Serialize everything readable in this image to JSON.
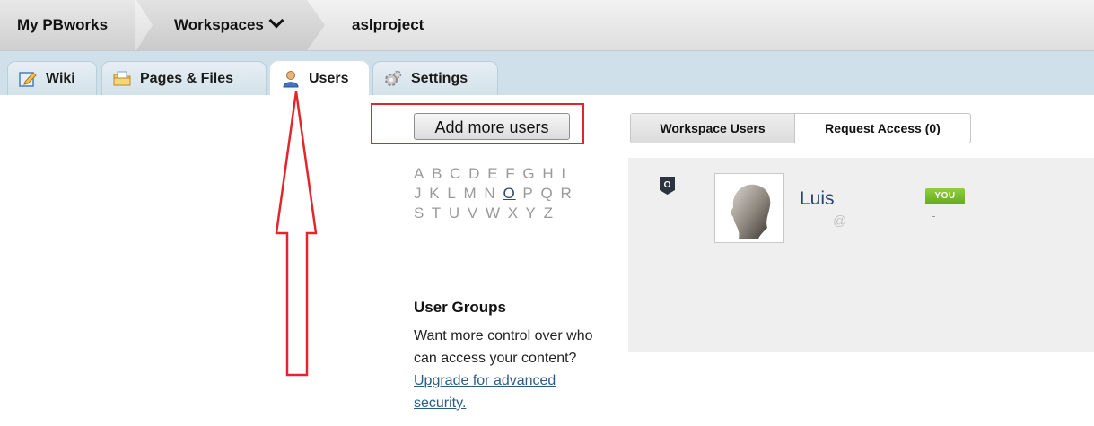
{
  "breadcrumb": {
    "home": "My PBworks",
    "workspaces": "Workspaces",
    "current": "aslproject"
  },
  "tabs": [
    {
      "label": "Wiki",
      "icon": "wiki-edit-icon"
    },
    {
      "label": "Pages & Files",
      "icon": "folder-icon"
    },
    {
      "label": "Users",
      "icon": "user-icon",
      "active": true
    },
    {
      "label": "Settings",
      "icon": "gear-icon"
    }
  ],
  "add_users_button": "Add more users",
  "alphabet": {
    "row1": [
      "A",
      "B",
      "C",
      "D",
      "E",
      "F",
      "G",
      "H",
      "I"
    ],
    "row2": [
      "J",
      "K",
      "L",
      "M",
      "N",
      "O",
      "P",
      "Q",
      "R"
    ],
    "row3": [
      "S",
      "T",
      "U",
      "V",
      "W",
      "X",
      "Y",
      "Z"
    ],
    "selected": "O"
  },
  "user_groups": {
    "title": "User Groups",
    "text": "Want more control over who can access your content?",
    "link": "Upgrade for advanced security."
  },
  "user_tabs": {
    "workspace_users": "Workspace Users",
    "request_access": "Request Access (0)"
  },
  "user": {
    "role_badge": "O",
    "name": "Luis",
    "email": "@",
    "you_badge": "YOU"
  },
  "colors": {
    "annotation_red": "#e2262c",
    "tab_strip": "#cfe0ea",
    "link_blue": "#2c5b86",
    "you_green": "#67a91d"
  }
}
